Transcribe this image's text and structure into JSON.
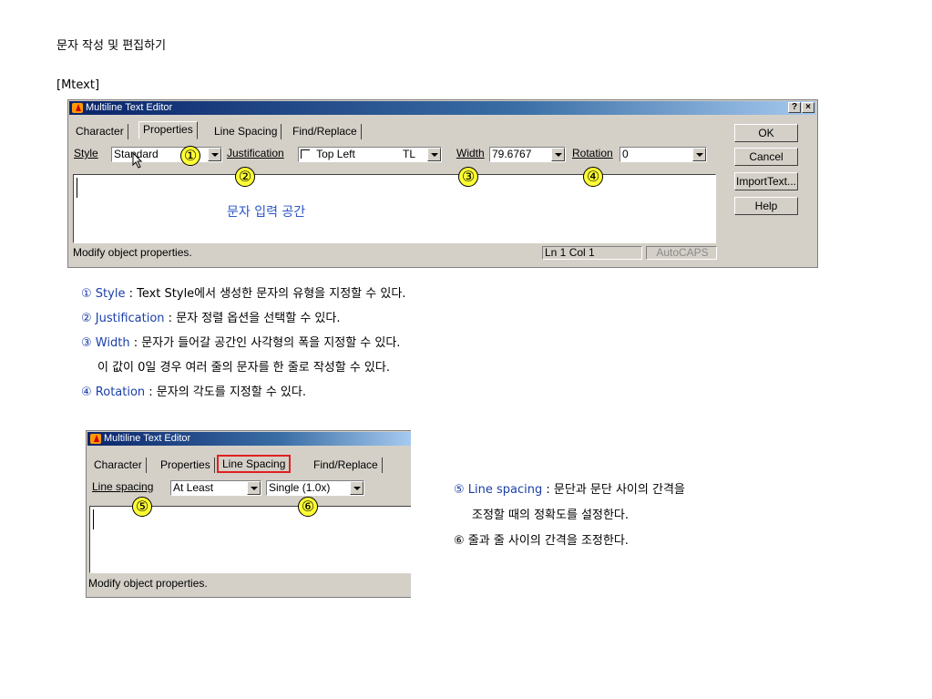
{
  "doc_title": "문자 작성 및 편집하기",
  "section_label": "[Mtext]",
  "dialog1": {
    "title": "Multiline Text Editor",
    "help_btn": "?",
    "close_btn": "×",
    "tabs": [
      "Character",
      "Properties",
      "Line Spacing",
      "Find/Replace"
    ],
    "style_label": "Style",
    "style_value": "Standard",
    "justification_label": "Justification",
    "justification_value": "Top Left",
    "justification_code": "TL",
    "width_label": "Width",
    "width_value": "79.6767",
    "rotation_label": "Rotation",
    "rotation_value": "0",
    "text_area_hint": "문자 입력 공간",
    "buttons": [
      "OK",
      "Cancel",
      "ImportText...",
      "Help"
    ],
    "status_text": "Modify object properties.",
    "status_position": "Ln 1 Col 1",
    "status_caps": "AutoCAPS",
    "badges": [
      "①",
      "②",
      "③",
      "④"
    ]
  },
  "notes1": [
    {
      "kw": "① Style",
      "text": " : Text Style에서 생성한 문자의 유형을 지정할 수 있다."
    },
    {
      "kw": "② Justification",
      "text": " : 문자 정렬 옵션을 선택할 수 있다."
    },
    {
      "kw": "③ Width",
      "text": " : 문자가 들어갈 공간인 사각형의 폭을 지정할 수 있다."
    },
    {
      "kw": "",
      "text": "이 값이 0일 경우 여러 줄의 문자를 한 줄로 작성할 수 있다."
    },
    {
      "kw": "④ Rotation",
      "text": " : 문자의 각도를 지정할 수 있다."
    }
  ],
  "dialog2": {
    "title": "Multiline Text Editor",
    "tabs": [
      "Character",
      "Properties",
      "Line Spacing",
      "Find/Replace"
    ],
    "line_spacing_label": "Line spacing",
    "line_spacing_value": "At Least",
    "factor_value": "Single (1.0x)",
    "status_text": "Modify object properties.",
    "badges": [
      "⑤",
      "⑥"
    ]
  },
  "notes2": [
    {
      "kw": "⑤ Line spacing",
      "text": " : 문단과 문단 사이의 간격을"
    },
    {
      "kw": "",
      "text": "조정할 때의 정확도를 설정한다."
    },
    {
      "kw": "",
      "text": "⑥ 줄과 줄 사이의 간격을 조정한다."
    }
  ],
  "colors": {
    "title_bar": "#0a246a",
    "keyword_blue": "#1a3fa8",
    "badge_yellow": "#ffff33",
    "highlight_red": "#e02020"
  }
}
